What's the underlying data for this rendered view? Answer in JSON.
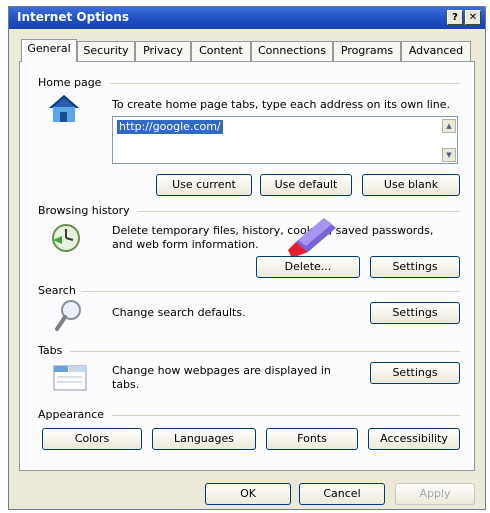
{
  "window": {
    "title": "Internet Options",
    "help": "?",
    "close": "✕"
  },
  "tabs": [
    "General",
    "Security",
    "Privacy",
    "Content",
    "Connections",
    "Programs",
    "Advanced"
  ],
  "home": {
    "heading": "Home page",
    "description": "To create home page tabs, type each address on its own line.",
    "url": "http://google.com/",
    "buttons": [
      "Use current",
      "Use default",
      "Use blank"
    ]
  },
  "history": {
    "heading": "Browsing history",
    "line1": "Delete temporary files, history, cookies, saved passwords,",
    "line2": "and web form information.",
    "delete_btn": "Delete...",
    "settings_btn": "Settings"
  },
  "search": {
    "heading": "Search",
    "description": "Change search defaults.",
    "settings_btn": "Settings"
  },
  "tabs_group": {
    "heading": "Tabs",
    "line1": "Change how webpages are displayed in",
    "line2": "tabs.",
    "settings_btn": "Settings"
  },
  "appearance": {
    "heading": "Appearance",
    "buttons": [
      "Colors",
      "Languages",
      "Fonts",
      "Accessibility"
    ]
  },
  "footer": {
    "ok": "OK",
    "cancel": "Cancel",
    "apply": "Apply"
  }
}
